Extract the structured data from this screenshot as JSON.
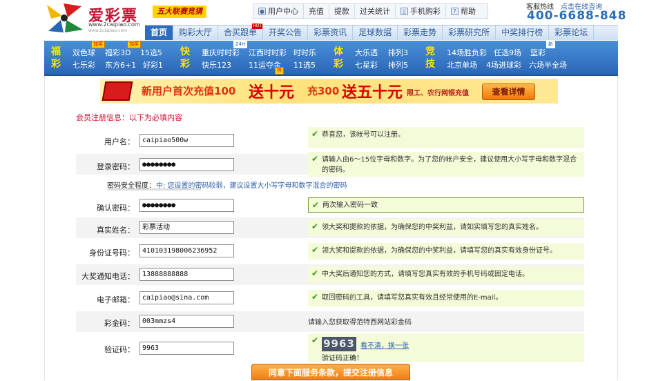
{
  "header": {
    "logo_title": "爱彩票",
    "logo_url": "www.2caipiao.com",
    "logo_sub": "www.2caipiao.com",
    "promo": "五大联赛竞猜",
    "util": [
      {
        "label": "用户中心",
        "icon": "user-icon"
      },
      {
        "label": "充值",
        "icon": ""
      },
      {
        "label": "提款",
        "icon": ""
      },
      {
        "label": "过关统计",
        "icon": ""
      },
      {
        "label": "手机购彩",
        "icon": "phone-icon"
      },
      {
        "label": "帮助",
        "icon": "help-icon"
      }
    ],
    "hotline_label": "客服热线",
    "online_link": "点击在线咨询",
    "hotline": "400-6688-848"
  },
  "nav": {
    "items": [
      "首页",
      "购彩大厅",
      "合买跟单",
      "开奖公告",
      "彩票资讯",
      "足球数据",
      "彩票走势",
      "彩票研究所",
      "中奖排行榜",
      "彩票论坛"
    ],
    "hot_badge": "HOT"
  },
  "lottery": {
    "cat1": "福彩",
    "cat2": "快彩",
    "cat3": "体彩",
    "cat4": "竞技",
    "games": {
      "g1": "双色球",
      "g2": "福彩3D",
      "g3": "15选5",
      "g4": "七乐彩",
      "g5": "东方6+1",
      "g6": "好彩1",
      "g7": "重庆时时彩",
      "g8": "江西时时彩",
      "g9": "时时乐",
      "g10": "快乐123",
      "g11": "11运夺金",
      "g12": "11选5",
      "g13": "大乐透",
      "g14": "排列3",
      "g15": "七星彩",
      "g16": "排列5",
      "g17": "14场胜负彩",
      "g18": "任选9场",
      "g19": "篮彩",
      "g20": "北京单场",
      "g21": "4场进球彩",
      "g22": "六场半全场"
    },
    "badges": {
      "jiajiang": "加奖",
      "h24": "24H",
      "new": "新",
      "re": "热"
    }
  },
  "banner": {
    "t1": "新用户首次充值100",
    "t2": "送十元",
    "t3": "充300",
    "t4": "送五十元",
    "t5": "限工、农行网银充值",
    "btn": "查看详情"
  },
  "form": {
    "title": "会员注册信息：以下为必填内容",
    "rows": [
      {
        "label": "用户名：",
        "value": "caipiao500w",
        "hint": "恭喜您，该帐号可以注册。"
      },
      {
        "label": "登录密码：",
        "value": "●●●●●●●●",
        "hint": "请输入由6～15位字母和数字。为了您的帐户安全，建议使用大小写字母和数字混合的密码。"
      },
      {
        "label": "确认密码：",
        "value": "●●●●●●●●",
        "hint": "两次输入密码一致"
      },
      {
        "label": "真实姓名：",
        "value": "彩票活动",
        "hint": "领大奖和提款的依据，为确保您的中奖利益，请如实填写您的真实姓名。"
      },
      {
        "label": "身份证号码：",
        "value": "410103198006236952",
        "hint": "领大奖和提款的依据，为确保您的中奖利益，请填写您的真实有效身份证号。"
      },
      {
        "label": "大奖通知电话：",
        "value": "13888888888",
        "hint": "中大奖后通知您的方式，请填写您真实有效的手机号码或固定电话。"
      },
      {
        "label": "电子邮箱：",
        "value": "caipiao@sina.com",
        "hint": "取回密码的工具，请填写您真实有效且经常使用的E-mail。"
      },
      {
        "label": "彩金码：",
        "value": "003mmzs4",
        "hint": "请输入您获取得范特西网站彩金码"
      },
      {
        "label": "验证码：",
        "value": "9963",
        "hint": ""
      }
    ],
    "strength_label": "密码安全程度：",
    "strength_text": "中: 您设置的密码较弱，建议设置大小写字母和数字混合的密码",
    "captcha": "9963",
    "captcha_refresh": "看不清，换一张",
    "captcha_ok": "验证码正确！",
    "submit": "同意下面服务条款，提交注册信息"
  },
  "colors": {
    "brand_red": "#c8102e",
    "nav_blue": "#2e6cbf",
    "hint_green": "#f4fbd9",
    "check_green": "#3d9a1a",
    "button_orange": "#f17f14"
  }
}
